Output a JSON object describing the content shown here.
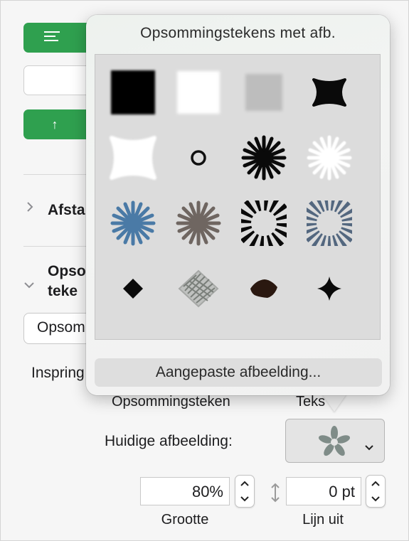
{
  "inspector": {
    "section_spacing": "Afsta",
    "section_bullets_line1": "Opso",
    "section_bullets_line2": "teke",
    "bullet_style_value": "Opsom",
    "indent_label": "Inspring",
    "subcolumn_bullet": "Opsommingsteken",
    "subcolumn_text": "Teks",
    "current_image_label": "Huidige afbeelding:",
    "size_value": "80%",
    "size_caption": "Grootte",
    "align_value": "0 pt",
    "align_caption": "Lijn uit"
  },
  "popover": {
    "title": "Opsommingstekens met afb.",
    "custom_button": "Aangepaste afbeelding...",
    "bullets": [
      "black-square-bullet",
      "white-square-bullet",
      "gray-square-bullet",
      "black-blob-bullet",
      "white-blob-bullet",
      "small-ring-bullet",
      "black-starburst-bullet",
      "white-starburst-bullet",
      "blue-starburst-bullet",
      "brown-starburst-bullet",
      "black-sunburst-bullet",
      "blue-sunburst-bullet",
      "black-diamond-bullet",
      "gray-scribble-diamond-bullet",
      "brown-ink-blot-bullet",
      "black-four-point-star-bullet"
    ]
  },
  "colors": {
    "accent_green": "#2fa04f",
    "steel_blue": "#4a7aa6",
    "taupe": "#6f6661"
  }
}
